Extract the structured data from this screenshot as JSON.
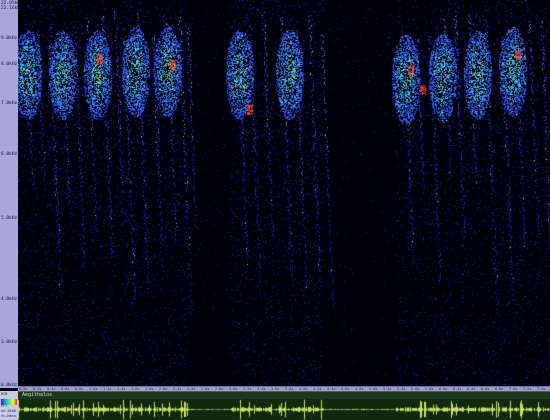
{
  "frequency_axis": {
    "labels": [
      "22.05kHz",
      "22.16kHz",
      "9.0kHz",
      "8.0kHz",
      "7.0kHz",
      "6.0kHz",
      "5.0kHz",
      "4.0kHz",
      "3.0kHz",
      "0.0kHz"
    ]
  },
  "time_axis": {
    "labels": [
      "0.0s",
      "0.2s",
      "0.4s",
      "0.6s",
      "0.8s",
      "1.0s",
      "1.2s",
      "1.4s",
      "1.6s",
      "1.8s",
      "2.0s",
      "2.2s",
      "2.4s",
      "2.6s",
      "2.8s",
      "3.0s",
      "3.2s",
      "3.4s",
      "3.6s",
      "3.8s",
      "4.0s",
      "4.2s",
      "4.4s",
      "4.6s",
      "4.8s",
      "5.0s",
      "5.2s",
      "5.4s",
      "5.6s",
      "5.8s",
      "6.0s",
      "6.2s",
      "6.4s",
      "6.6s",
      "6.8s",
      "7.0s",
      "7.2s",
      "7.4s"
    ]
  },
  "palette": {
    "top_label": "RCB",
    "bottom_labels": [
      "FFT",
      "sn-2048",
      "fc-Hann"
    ]
  },
  "waveform": {
    "track_label": "Aegithalos"
  },
  "colors": {
    "background": "#000000",
    "ruler": "#a8a8d8",
    "wave": "#c8e060",
    "wave_bg": "#0f2a0f"
  }
}
